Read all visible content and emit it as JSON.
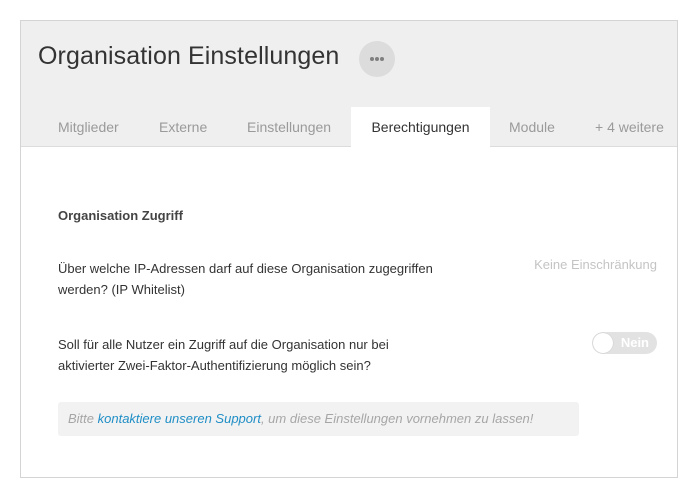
{
  "header": {
    "title": "Organisation Einstellungen",
    "more_icon": "ellipsis-icon"
  },
  "tabs": [
    {
      "label": "Mitglieder",
      "active": false
    },
    {
      "label": "Externe",
      "active": false
    },
    {
      "label": "Einstellungen",
      "active": false
    },
    {
      "label": "Berechtigungen",
      "active": true
    },
    {
      "label": "Module",
      "active": false
    },
    {
      "label": "+ 4 weitere",
      "active": false
    }
  ],
  "section": {
    "title": "Organisation Zugriff"
  },
  "ip_whitelist": {
    "question": "Über welche IP-Adressen darf auf diese Organisation zugegriffen werden? (IP Whitelist)",
    "value": "Keine Einschränkung"
  },
  "two_factor": {
    "question": "Soll für alle Nutzer ein Zugriff auf die Organisation nur bei aktivierter Zwei-Faktor-Authentifizierung möglich sein?",
    "toggle_label": "Nein",
    "enabled": false
  },
  "note": {
    "prefix": "Bitte ",
    "link": "kontaktiere unseren Support",
    "suffix": ", um diese Einstellungen vornehmen zu lassen!"
  },
  "colors": {
    "accent_link": "#1f8ec6",
    "header_bg": "#efefef"
  }
}
